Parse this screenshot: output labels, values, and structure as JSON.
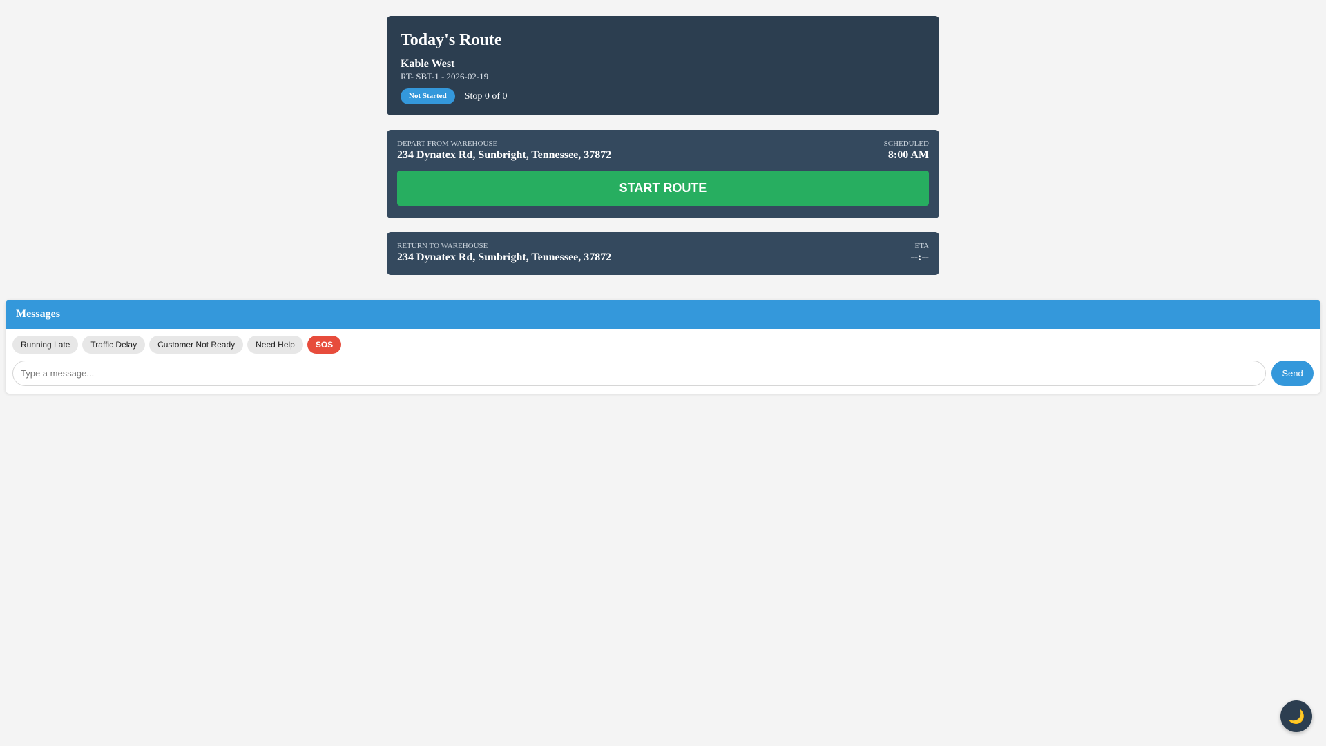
{
  "route": {
    "title": "Today's Route",
    "driver_name": "Kable West",
    "route_id": "RT- SBT-1 - 2026-02-19",
    "status": "Not Started",
    "stop_progress": "Stop 0 of 0"
  },
  "depart": {
    "label": "DEPART FROM WAREHOUSE",
    "address": "234 Dynatex Rd, Sunbright, Tennessee, 37872",
    "time_label": "SCHEDULED",
    "time": "8:00 AM",
    "start_button": "START ROUTE"
  },
  "return": {
    "label": "RETURN TO WAREHOUSE",
    "address": "234 Dynatex Rd, Sunbright, Tennessee, 37872",
    "time_label": "ETA",
    "time": "--:--"
  },
  "messages": {
    "title": "Messages",
    "quick_replies": [
      "Running Late",
      "Traffic Delay",
      "Customer Not Ready",
      "Need Help",
      "SOS"
    ],
    "input_placeholder": "Type a message...",
    "input_value": "",
    "send_label": "Send"
  },
  "theme_toggle": {
    "icon": "moon-icon",
    "glyph": "🌙"
  },
  "colors": {
    "header_bg": "#2c3e50",
    "card_bg": "#34495e",
    "accent_blue": "#3498db",
    "start_green": "#27ae60",
    "sos_red": "#e74c3c"
  }
}
